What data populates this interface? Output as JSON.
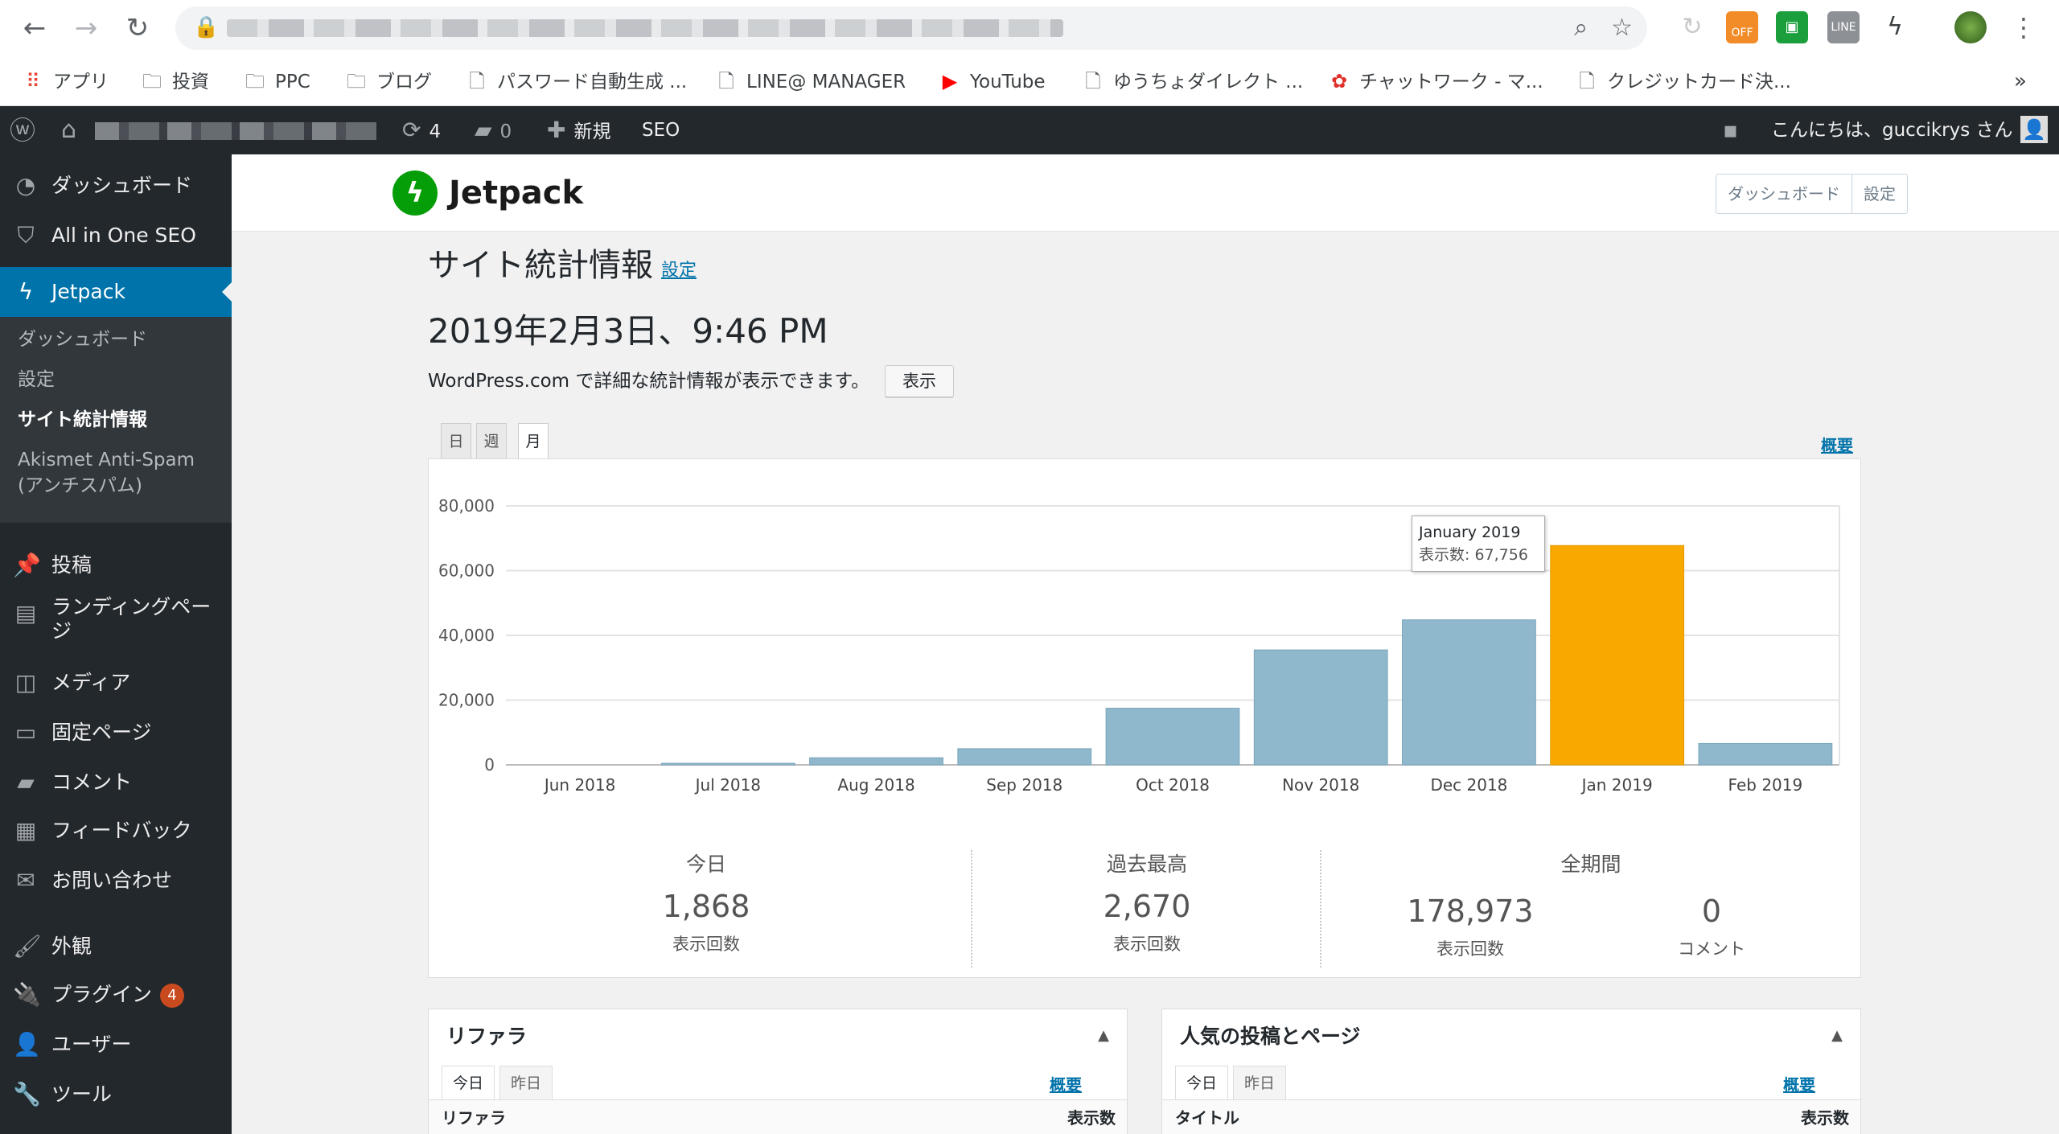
{
  "browser": {
    "bookmarks": [
      {
        "label": "アプリ",
        "icon": "apps-grid-icon"
      },
      {
        "label": "投資",
        "icon": "folder-icon"
      },
      {
        "label": "PPC",
        "icon": "folder-icon"
      },
      {
        "label": "ブログ",
        "icon": "folder-icon"
      },
      {
        "label": "パスワード自動生成 ...",
        "icon": "page-icon"
      },
      {
        "label": "LINE@ MANAGER",
        "icon": "page-icon"
      },
      {
        "label": "YouTube",
        "icon": "youtube-icon"
      },
      {
        "label": "ゆうちょダイレクト ...",
        "icon": "page-icon"
      },
      {
        "label": "チャットワーク - マ...",
        "icon": "chatwork-icon"
      },
      {
        "label": "クレジットカード決...",
        "icon": "page-icon"
      }
    ],
    "more": "»",
    "ext_off_label": "OFF"
  },
  "adminbar": {
    "updates": "4",
    "comments": "0",
    "new_label": "新規",
    "seo_label": "SEO",
    "greeting": "こんにちは、guccikrys さん"
  },
  "sidebar": {
    "items": [
      {
        "label": "ダッシュボード",
        "icon": "dashboard-icon"
      },
      {
        "label": "All in One SEO",
        "icon": "shield-icon"
      },
      {
        "label": "Jetpack",
        "icon": "jetpack-icon"
      }
    ],
    "submenu": [
      "ダッシュボード",
      "設定",
      "サイト統計情報",
      "Akismet Anti-Spam",
      "(アンチスパム)"
    ],
    "items2": [
      {
        "label": "投稿",
        "icon": "pin-icon"
      },
      {
        "label": "ランディングペー",
        "label2": "ジ",
        "icon": "landing-page-icon"
      },
      {
        "label": "メディア",
        "icon": "media-icon"
      },
      {
        "label": "固定ページ",
        "icon": "pages-icon"
      },
      {
        "label": "コメント",
        "icon": "comment-icon"
      },
      {
        "label": "フィードバック",
        "icon": "feedback-icon"
      },
      {
        "label": "お問い合わせ",
        "icon": "mail-icon"
      },
      {
        "label": "外観",
        "icon": "brush-icon"
      },
      {
        "label": "プラグイン",
        "icon": "plugin-icon",
        "badge": "4"
      },
      {
        "label": "ユーザー",
        "icon": "user-icon"
      },
      {
        "label": "ツール",
        "icon": "wrench-icon"
      }
    ]
  },
  "jetpack": {
    "name": "Jetpack",
    "nav": [
      "ダッシュボード",
      "設定"
    ]
  },
  "page": {
    "title": "サイト統計情報",
    "title_link": "設定",
    "date": "2019年2月3日、9:46 PM",
    "wpcom_text": "WordPress.com で詳細な統計情報が表示できます。",
    "show_button": "表示",
    "tabs": [
      "日",
      "週",
      "月"
    ],
    "overview_link": "概要"
  },
  "chart_data": {
    "type": "bar",
    "categories": [
      "Jun 2018",
      "Jul 2018",
      "Aug 2018",
      "Sep 2018",
      "Oct 2018",
      "Nov 2018",
      "Dec 2018",
      "Jan 2019",
      "Feb 2019"
    ],
    "values": [
      0,
      300,
      2200,
      5000,
      17500,
      35500,
      44800,
      67756,
      6600
    ],
    "highlight_index": 7,
    "ylim": [
      0,
      80000
    ],
    "yticks": [
      "0",
      "20,000",
      "40,000",
      "60,000",
      "80,000"
    ],
    "bar_color": "#8fb8cc",
    "highlight_color": "#f9a800",
    "tooltip": {
      "title": "January 2019",
      "text": "表示数: 67,756"
    },
    "grid": true
  },
  "summary": {
    "today": {
      "label": "今日",
      "value": "1,868",
      "unit": "表示回数"
    },
    "best": {
      "label": "過去最高",
      "value": "2,670",
      "unit": "表示回数"
    },
    "all_time": {
      "label": "全期間",
      "views": "178,973",
      "views_unit": "表示回数",
      "comments": "0",
      "comments_unit": "コメント"
    }
  },
  "modules": {
    "referrers": {
      "title": "リファラ",
      "tabs": [
        "今日",
        "昨日"
      ],
      "link": "概要",
      "col1": "リファラ",
      "col2": "表示数"
    },
    "popular": {
      "title": "人気の投稿とページ",
      "tabs": [
        "今日",
        "昨日"
      ],
      "link": "概要",
      "col1": "タイトル",
      "col2": "表示数"
    }
  }
}
